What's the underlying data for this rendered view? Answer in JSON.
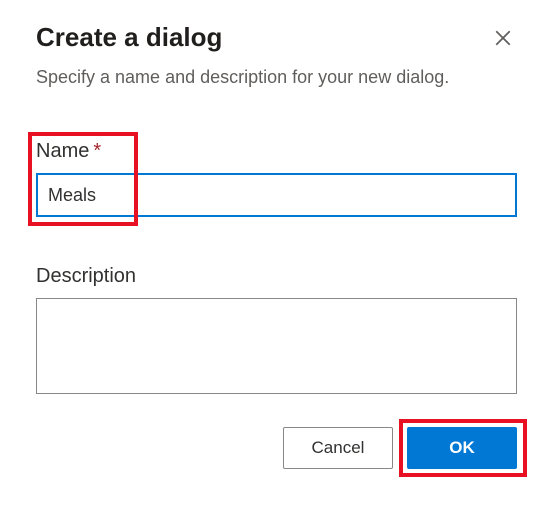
{
  "header": {
    "title": "Create a dialog",
    "subtitle": "Specify a name and description for your new dialog."
  },
  "fields": {
    "name": {
      "label": "Name",
      "required_marker": "*",
      "value": "Meals"
    },
    "description": {
      "label": "Description",
      "value": ""
    }
  },
  "buttons": {
    "cancel": "Cancel",
    "ok": "OK"
  },
  "icons": {
    "close": "close"
  }
}
